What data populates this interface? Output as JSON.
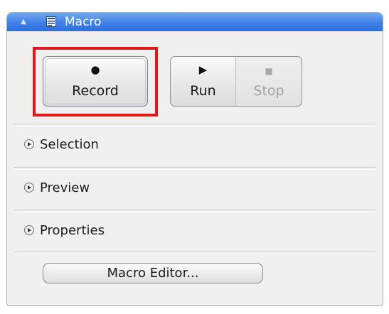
{
  "panel": {
    "title": "Macro",
    "collapse_icon": "chevron-up-icon",
    "title_icon": "macro-panel-icon"
  },
  "toolbar": {
    "record": {
      "label": "Record",
      "icon": "record-dot-icon"
    },
    "run": {
      "label": "Run",
      "icon": "play-icon"
    },
    "stop": {
      "label": "Stop",
      "icon": "stop-square-icon",
      "enabled": false
    }
  },
  "sections": [
    {
      "label": "Selection",
      "icon": "expand-arrow-icon"
    },
    {
      "label": "Preview",
      "icon": "expand-arrow-icon"
    },
    {
      "label": "Properties",
      "icon": "expand-arrow-icon"
    }
  ],
  "editor_button": {
    "label": "Macro Editor..."
  },
  "colors": {
    "titlebar": "#3f80e8",
    "highlight": "#e0181c",
    "panel_bg": "#f0f0f0"
  }
}
